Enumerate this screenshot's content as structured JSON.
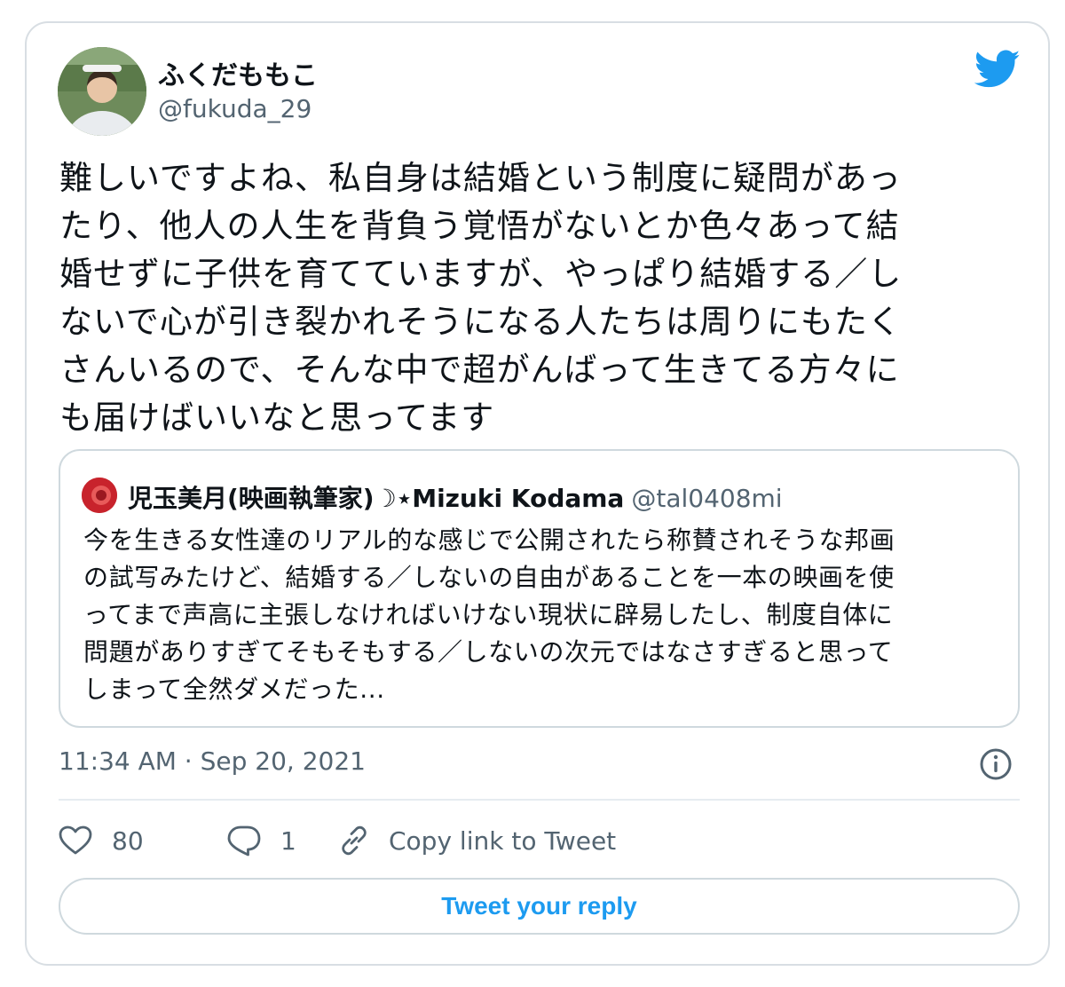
{
  "author": {
    "display_name": "ふくだももこ",
    "handle": "@fukuda_29"
  },
  "tweet": {
    "lines": [
      "難しいですよね、私自身は結婚という制度に疑問があっ",
      "たり、他人の人生を背負う覚悟がないとか色々あって結",
      "婚せずに子供を育てていますが、やっぱり結婚する／し",
      "ないで心が引き裂かれそうになる人たちは周りにもたく",
      "さんいるので、そんな中で超がんばって生きてる方々に",
      "も届けばいいなと思ってます"
    ]
  },
  "quoted": {
    "display_name": "児玉美月(映画執筆家)☽⋆Mizuki Kodama",
    "handle": "@tal0408mi",
    "lines": [
      "今を生きる女性達のリアル的な感じで公開されたら称賛されそうな邦画",
      "の試写みたけど、結婚する／しないの自由があることを一本の映画を使",
      "ってまで声高に主張しなければいけない現状に辟易したし、制度自体に",
      "問題がありすぎてそもそもする／しないの次元ではなさすぎると思って",
      "しまって全然ダメだった..."
    ]
  },
  "timestamp": "11:34 AM · Sep 20, 2021",
  "actions": {
    "like_count": "80",
    "reply_count": "1",
    "copy_link_label": "Copy link to Tweet"
  },
  "reply_button_label": "Tweet your reply",
  "colors": {
    "accent": "#1d9bf0",
    "secondary_text": "#536471",
    "border": "#cfd9de"
  },
  "icons": [
    "twitter-bird-icon",
    "info-icon",
    "heart-icon",
    "reply-bubble-icon",
    "link-icon"
  ]
}
